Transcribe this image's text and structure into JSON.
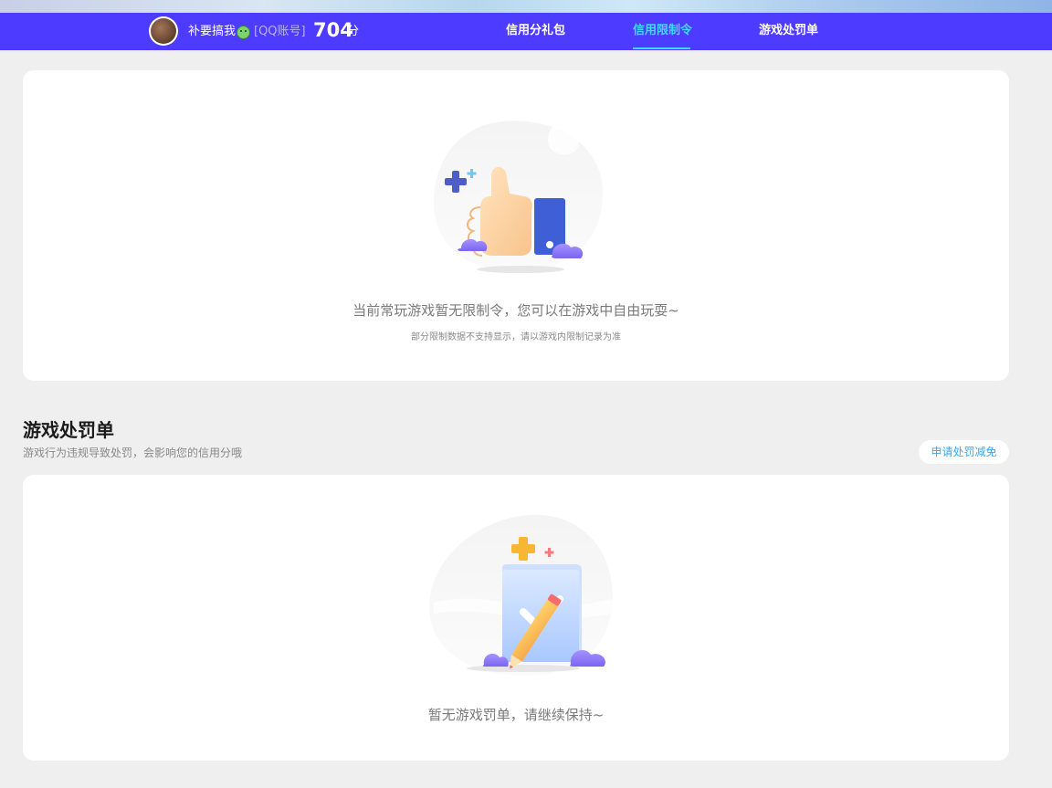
{
  "header": {
    "username": "补要搞我",
    "account_type": "[QQ账号]",
    "score_value": "704",
    "score_unit": "分",
    "tabs": [
      {
        "label": "信用分礼包",
        "active": false
      },
      {
        "label": "信用限制令",
        "active": true
      },
      {
        "label": "游戏处罚单",
        "active": false
      }
    ],
    "accent_color": "#45d6ff",
    "bar_color": "#4d3bff"
  },
  "restriction": {
    "empty_text": "当前常玩游戏暂无限制令，您可以在游戏中自由玩耍~",
    "note": "部分限制数据不支持显示，请以游戏内限制记录为准"
  },
  "penalty": {
    "title": "游戏处罚单",
    "description": "游戏行为违规导致处罚，会影响您的信用分哦",
    "appeal_button": "申请处罚减免",
    "empty_text": "暂无游戏罚单，请继续保持~"
  },
  "icons": {
    "thumbs_up": "thumbs-up-icon",
    "document_check": "document-check-icon",
    "emoji": "emoji-icon",
    "avatar": "avatar"
  }
}
